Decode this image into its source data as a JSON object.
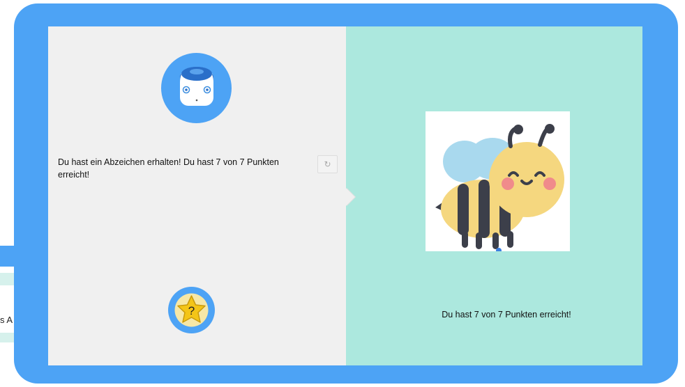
{
  "background": {
    "partial_text": "s A"
  },
  "dialog": {
    "message": "Du hast ein Abzeichen erhalten! Du hast 7 von 7 Punkten erreicht!",
    "replay_icon": "↻",
    "badge_symbol": "?",
    "result_text": "Du hast 7 von 7 Punkten erreicht!"
  },
  "icons": {
    "avatar": "robot-avatar-icon",
    "badge": "star-question-badge-icon",
    "replay": "replay-icon",
    "reward": "bee-image"
  },
  "colors": {
    "frame": "#4da3f5",
    "left_panel": "#f0f0f0",
    "right_panel": "#ace8de"
  }
}
